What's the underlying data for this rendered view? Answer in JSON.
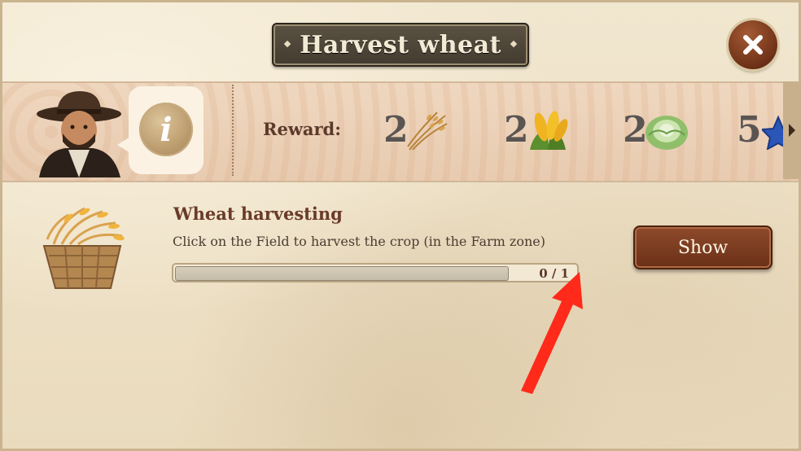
{
  "dialog": {
    "title": "Harvest wheat",
    "close_icon": "close-x-icon"
  },
  "quest_giver": {
    "portrait": "farmer-cowboy-portrait",
    "info_symbol": "i"
  },
  "reward": {
    "label": "Reward:",
    "items": [
      {
        "qty": "2",
        "icon": "wheat-icon"
      },
      {
        "qty": "2",
        "icon": "corn-icon"
      },
      {
        "qty": "2",
        "icon": "cabbage-icon"
      },
      {
        "qty": "5",
        "icon": "star-icon"
      }
    ]
  },
  "task": {
    "icon": "wheat-basket-icon",
    "title": "Wheat harvesting",
    "description": "Click on the Field to harvest the crop (in the Farm zone)",
    "progress_text": "0 / 1",
    "progress_fraction": 0.0,
    "show_label": "Show"
  },
  "colors": {
    "parchment": "#efe3cb",
    "title_plate": "#4f473a",
    "button_brown": "#7a3b20",
    "annotation_red": "#ff2a1a"
  }
}
